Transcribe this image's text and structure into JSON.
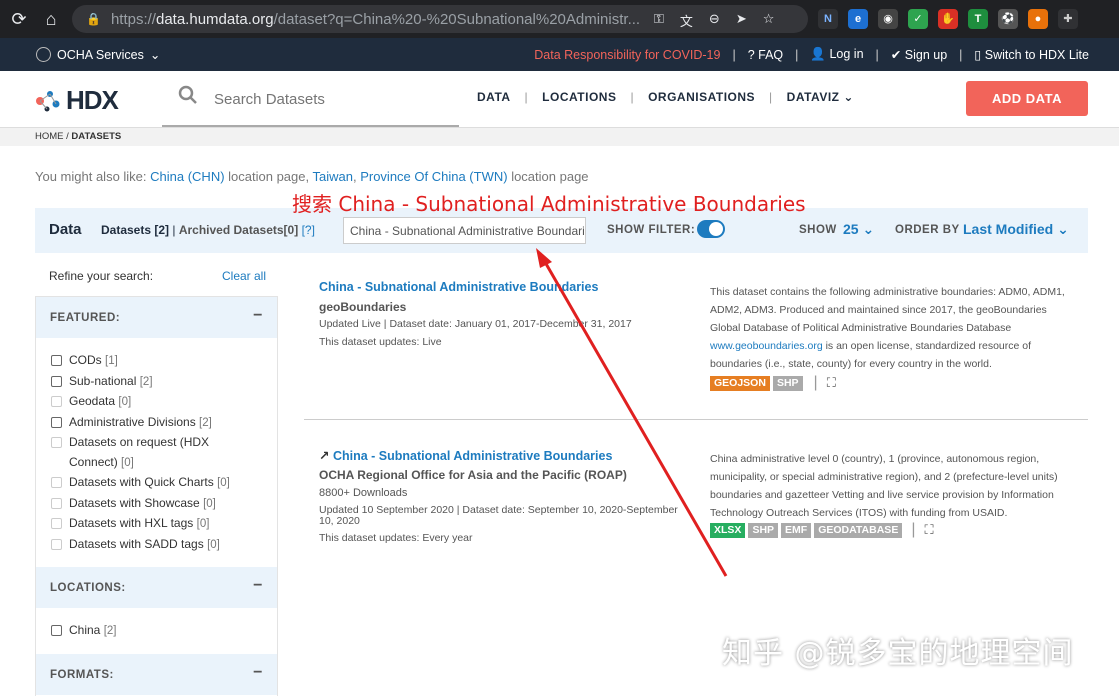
{
  "browser": {
    "url_scheme": "https://",
    "url_host": "data.humdata.org",
    "url_path": "/dataset?q=China%20-%20Subnational%20Administr..."
  },
  "topbar": {
    "ocha_services": "OCHA Services",
    "covid_link": "Data Responsibility for COVID-19",
    "faq": "FAQ",
    "login": "Log in",
    "signup": "Sign up",
    "lite": "Switch to HDX Lite"
  },
  "header": {
    "logo": "HDX",
    "search_placeholder": "Search Datasets",
    "nav": [
      "DATA",
      "LOCATIONS",
      "ORGANISATIONS",
      "DATAVIZ"
    ],
    "add_data": "ADD DATA"
  },
  "breadcrumb": {
    "home": "HOME",
    "sep": " / ",
    "current": "DATASETS"
  },
  "also_like": {
    "prefix": "You might also like: ",
    "link1": "China (CHN)",
    "mid1": " location page, ",
    "link2": "Taiwan",
    "mid2": ", ",
    "link3": "Province Of China (TWN)",
    "suffix": " location page"
  },
  "annotation": "搜索 China - Subnational Administrative Boundaries",
  "databar": {
    "title": "Data",
    "datasets": "Datasets [2]",
    "sep": " | ",
    "archived": "Archived Datasets[0]",
    "help": "[?]",
    "query": "China - Subnational Administrative Boundaries",
    "show_filter": "SHOW FILTER:",
    "show": "SHOW",
    "show_value": "25",
    "order_by": "ORDER BY",
    "order_value": "Last Modified"
  },
  "sidebar": {
    "refine": "Refine your search:",
    "clear_all": "Clear all",
    "featured_header": "FEATURED:",
    "featured": [
      {
        "label": "CODs",
        "count": "[1]"
      },
      {
        "label": "Sub-national",
        "count": "[2]"
      },
      {
        "label": "Geodata",
        "count": "[0]"
      },
      {
        "label": "Administrative Divisions",
        "count": "[2]"
      },
      {
        "label": "Datasets on request (HDX Connect)",
        "count": "[0]"
      },
      {
        "label": "Datasets with Quick Charts",
        "count": "[0]"
      },
      {
        "label": "Datasets with Showcase",
        "count": "[0]"
      },
      {
        "label": "Datasets with HXL tags",
        "count": "[0]"
      },
      {
        "label": "Datasets with SADD tags",
        "count": "[0]"
      }
    ],
    "locations_header": "LOCATIONS:",
    "locations": [
      {
        "label": "China",
        "count": "[2]"
      }
    ],
    "formats_header": "FORMATS:"
  },
  "results": [
    {
      "title": "China - Subnational Administrative Boundaries",
      "org": "geoBoundaries",
      "downloads": "",
      "meta": "Updated Live | Dataset date: January 01, 2017-December 31, 2017",
      "updates": "This dataset updates: Live",
      "desc_before": "This dataset contains the following administrative boundaries: ADM0, ADM1, ADM2, ADM3. Produced and maintained since 2017, the geoBoundaries Global Database of Political Administrative Boundaries Database ",
      "desc_link": "www.geoboundaries.org",
      "desc_after": " is an open license, standardized resource of boundaries (i.e., state, county) for every country in the world.",
      "tags": [
        {
          "label": "GEOJSON",
          "color": "#e67e22"
        },
        {
          "label": "SHP",
          "color": "#aaaaaa"
        }
      ]
    },
    {
      "title": "China - Subnational Administrative Boundaries",
      "org": "OCHA Regional Office for Asia and the Pacific (ROAP)",
      "downloads": "8800+ Downloads",
      "meta": "Updated 10 September 2020 | Dataset date: September 10, 2020-September 10, 2020",
      "updates": "This dataset updates: Every year",
      "desc_before": "China administrative level 0 (country), 1 (province, autonomous region, municipality, or special administrative region), and 2 (prefecture-level units) boundaries and gazetteer Vetting and live service provision by Information Technology Outreach Services (ITOS) with funding from USAID.",
      "desc_link": "",
      "desc_after": "",
      "tags": [
        {
          "label": "XLSX",
          "color": "#27ae60"
        },
        {
          "label": "SHP",
          "color": "#aaaaaa"
        },
        {
          "label": "EMF",
          "color": "#aaaaaa"
        },
        {
          "label": "GEODATABASE",
          "color": "#aaaaaa"
        }
      ]
    }
  ],
  "watermark": "知乎 @锐多宝的地理空间",
  "colors": {
    "accent": "#1d7bbf",
    "brand_red": "#f2645a",
    "dark": "#1f2c3d",
    "arrow": "#e02020"
  }
}
